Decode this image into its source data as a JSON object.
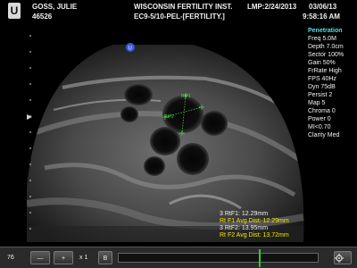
{
  "header": {
    "logo_letter": "U",
    "patient_name": "GOSS, JULIE",
    "patient_id": "46526",
    "institution": "WISCONSIN FERTILITY INST.",
    "study": "EC9-5/10-PEL-[FERTILITY.]",
    "lmp": "LMP:2/24/2013",
    "date": "03/06/13",
    "time": "9:58:16 AM"
  },
  "params": {
    "title": "Penetration",
    "items": [
      "Freq 5.0M",
      "Depth 7.0cm",
      "Sector 100%",
      "Gain 50%",
      "FrRate High",
      "FPS 40Hz",
      "Dyn 75dB",
      "Persist 2",
      "Map 5",
      "Chroma 0",
      "Power 0",
      "MI<0.70",
      "Clarity Med"
    ]
  },
  "image": {
    "orientation_marker": "U",
    "label_f1": "RtF1",
    "label_f2": "RtF2"
  },
  "measurements": {
    "line1": "3 RtF1: 12.29mm",
    "line2": "Rt F1 Avg Dist: 12.29mm",
    "line3": "3 RtF2: 13.95mm",
    "line4": "Rt F2 Avg Dist: 13.72mm"
  },
  "toolbar": {
    "zoom_value": "76",
    "minus": "—",
    "plus": "+",
    "magnification": "x 1",
    "b_mode": "B"
  },
  "colors": {
    "param_title": "#4ee0e8",
    "measurement_accent": "#f5e400",
    "cine_marker": "#2ecc2e",
    "caliper": "#4cd24c"
  }
}
